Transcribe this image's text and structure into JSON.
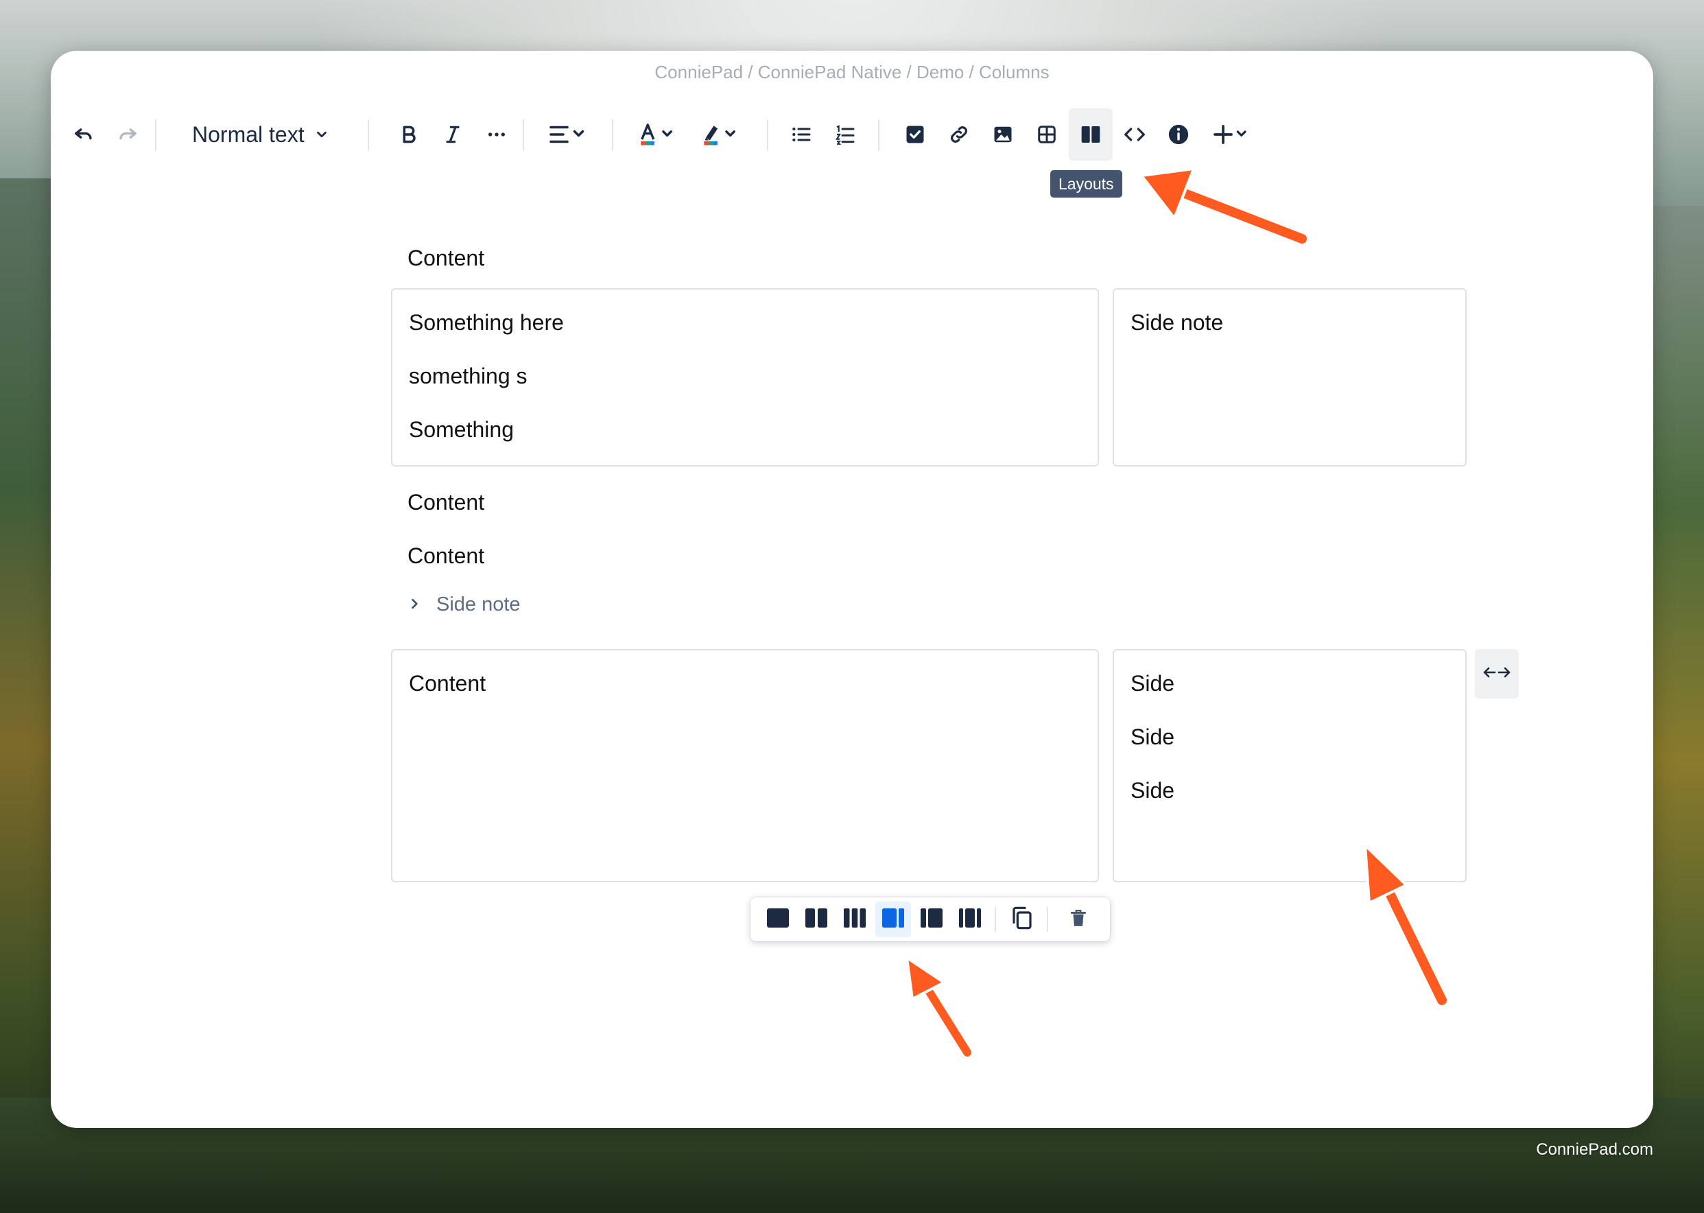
{
  "breadcrumb": "ConniePad / ConniePad Native / Demo / Columns",
  "toolbar": {
    "text_style": "Normal text",
    "tooltip": "Layouts",
    "icons": [
      "undo-icon",
      "redo-icon",
      "bold-icon",
      "italic-icon",
      "more-formatting-icon",
      "align-icon",
      "text-color-icon",
      "highlight-icon",
      "bullet-list-icon",
      "numbered-list-icon",
      "task-icon",
      "link-icon",
      "image-icon",
      "table-icon",
      "layouts-icon",
      "code-icon",
      "info-icon",
      "insert-plus-icon"
    ]
  },
  "document": {
    "p1": "Content",
    "layout1": {
      "col1": [
        "Something here",
        "something s",
        "Something"
      ],
      "col2": [
        "Side note"
      ]
    },
    "p2": "Content",
    "p3": "Content",
    "expand_label": "Side note",
    "layout2": {
      "col1": [
        "Content"
      ],
      "col2": [
        "Side",
        "Side",
        "Side"
      ]
    }
  },
  "layout_options": [
    "single-column",
    "two-columns",
    "three-columns",
    "left-sidebar",
    "right-sidebar",
    "three-columns-sidebars",
    "copy",
    "delete"
  ],
  "layout_selected": "left-sidebar",
  "colors": {
    "accent": "#0c66e4",
    "annotation": "#ff5a1f",
    "icon": "#1c2b41",
    "tooltip": "#44546f"
  },
  "watermark": "ConniePad.com"
}
